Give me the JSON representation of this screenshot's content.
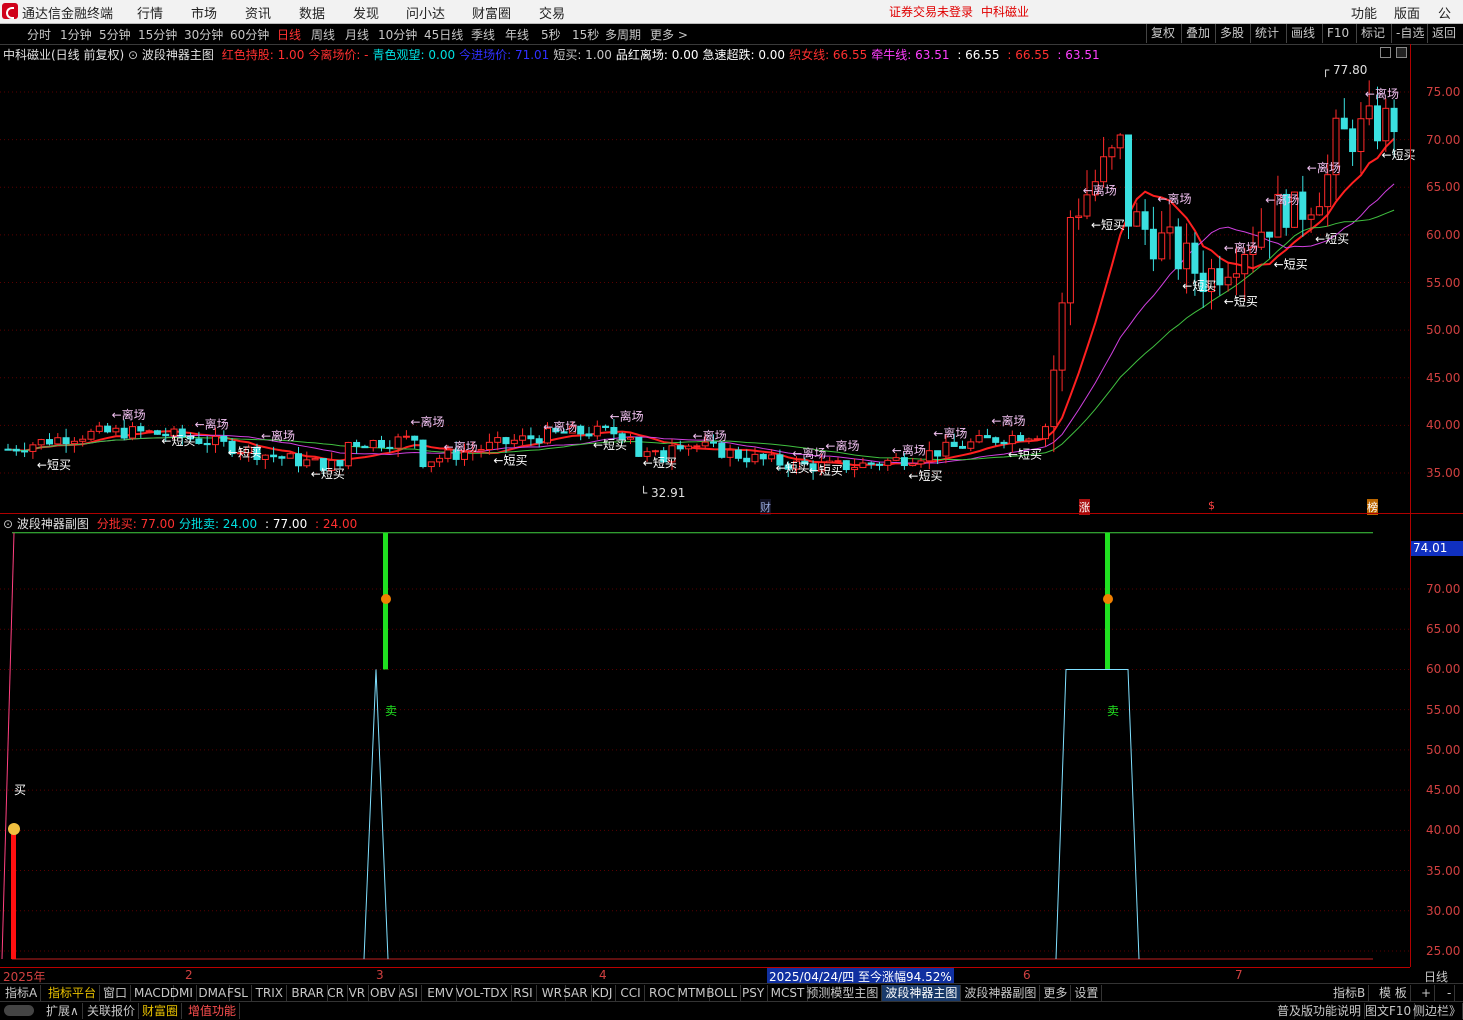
{
  "app": {
    "title": "通达信金融终端",
    "menu": [
      "行情",
      "市场",
      "资讯",
      "数据",
      "发现",
      "问小达",
      "财富圈",
      "交易"
    ],
    "notice": "证券交易未登录",
    "notice_stock": "中科磁业",
    "right_menu": [
      "功能",
      "版面",
      "公式"
    ]
  },
  "toolbar": {
    "periods": [
      "分时",
      "1分钟",
      "5分钟",
      "15分钟",
      "30分钟",
      "60分钟",
      "日线",
      "周线",
      "月线",
      "10分钟",
      "45日线",
      "季线",
      "年线",
      "5秒",
      "15秒",
      "多周期",
      "更多 >"
    ],
    "active_period": "日线",
    "right_buttons": [
      "复权",
      "叠加",
      "多股",
      "统计",
      "画线",
      "F10",
      "标记",
      "-自选",
      "返回"
    ]
  },
  "main_info": {
    "stock": "中科磁业(日线 前复权)",
    "indicator": "波段神器主图",
    "items": [
      {
        "label": "红色持股:",
        "value": "1.00",
        "color": "#ff3030"
      },
      {
        "label": "今离场价:",
        "value": "-",
        "color": "#ff3030"
      },
      {
        "label": "青色观望:",
        "value": "0.00",
        "color": "#00e0e0"
      },
      {
        "label": "今进场价:",
        "value": "71.01",
        "color": "#3030ff"
      },
      {
        "label": "短买:",
        "value": "1.00",
        "color": "#c8c8c8"
      },
      {
        "label": "品红离场:",
        "value": "0.00",
        "color": "#ffffff"
      },
      {
        "label": "急速超跌:",
        "value": "0.00",
        "color": "#ffffff"
      },
      {
        "label": "织女线:",
        "value": "66.55",
        "color": "#ff3030"
      },
      {
        "label": "牵牛线:",
        "value": "63.51",
        "color": "#ff40ff"
      },
      {
        "label": "",
        "value": ": 66.55",
        "color": "#ffffff"
      },
      {
        "label": "",
        "value": ": 66.55",
        "color": "#ff3030"
      },
      {
        "label": "",
        "value": ": 63.51",
        "color": "#ff40ff"
      }
    ]
  },
  "sub_info": {
    "indicator": "波段神器副图",
    "items": [
      {
        "label": "分批买:",
        "value": "77.00",
        "color": "#ff3030"
      },
      {
        "label": "分批卖:",
        "value": "24.00",
        "color": "#00e0e0"
      },
      {
        "label": "",
        "value": ": 77.00",
        "color": "#ffffff"
      },
      {
        "label": "",
        "value": ": 24.00",
        "color": "#ff3030"
      }
    ],
    "current_value": "74.01"
  },
  "main_axis": [
    "75.00",
    "70.00",
    "65.00",
    "60.00",
    "55.00",
    "50.00",
    "45.00",
    "40.00",
    "35.00"
  ],
  "sub_axis": [
    "70.00",
    "65.00",
    "60.00",
    "55.00",
    "50.00",
    "45.00",
    "40.00",
    "35.00",
    "30.00",
    "25.00"
  ],
  "annotations": {
    "high": "77.80",
    "low": "32.91",
    "exit": "←离场",
    "short_buy": "←短买",
    "buy": "买",
    "sell": "卖",
    "markers": [
      "财",
      "涨",
      "$",
      "榜"
    ]
  },
  "time_axis": {
    "labels": [
      "2025年",
      "2",
      "3",
      "4",
      "6",
      "7"
    ],
    "cursor": "2025/04/24/四  至今涨幅94.52%",
    "period": "日线"
  },
  "bottom_tabs": [
    "指标A",
    "指标平台",
    "窗口",
    "MACD",
    "DMI",
    "DMA",
    "FSL",
    "TRIX",
    "BRAR",
    "CR",
    "VR",
    "OBV",
    "ASI",
    "EMV",
    "VOL-TDX",
    "RSI",
    "WR",
    "SAR",
    "KDJ",
    "CCI",
    "ROC",
    "MTM",
    "BOLL",
    "PSY",
    "MCST",
    "预测模型主图",
    "波段神器主图",
    "波段神器副图",
    "更多",
    "设置"
  ],
  "bottom_right": [
    "指标B",
    "模 板",
    "+",
    "-"
  ],
  "status_tabs": [
    "扩展∧",
    "关联报价",
    "财富圈",
    "增值功能"
  ],
  "status_right": [
    "普及版功能说明",
    "图文F10",
    "侧边栏》"
  ]
}
